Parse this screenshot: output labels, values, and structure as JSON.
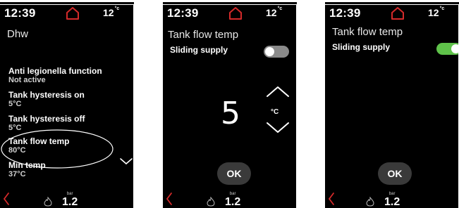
{
  "colors": {
    "accent_red": "#d42a2a",
    "toggle_off": "#8a8a8a",
    "toggle_on": "#5fc24a",
    "button_bg": "#3a3a3a"
  },
  "status": {
    "time": "12:39",
    "outdoor_temp": "12",
    "outdoor_unit": "°c"
  },
  "bottom": {
    "pressure_unit": "bar",
    "pressure_value": "1.2"
  },
  "menu_screen": {
    "title": "Dhw",
    "items": [
      {
        "label": "Anti legionella function",
        "value": "Not active"
      },
      {
        "label": "Tank hysteresis on",
        "value": "5°C"
      },
      {
        "label": "Tank hysteresis off",
        "value": "5°C"
      },
      {
        "label": "Tank flow temp",
        "value": "80°C"
      },
      {
        "label": "Min temp",
        "value": "37°C"
      }
    ]
  },
  "edit_screen_off": {
    "title": "Tank flow temp",
    "toggle_label": "Sliding supply",
    "toggle_on": false,
    "value": "5",
    "unit": "°C",
    "ok_label": "OK"
  },
  "edit_screen_on": {
    "title": "Tank flow temp",
    "toggle_label": "Sliding supply",
    "toggle_on": true,
    "ok_label": "OK"
  }
}
